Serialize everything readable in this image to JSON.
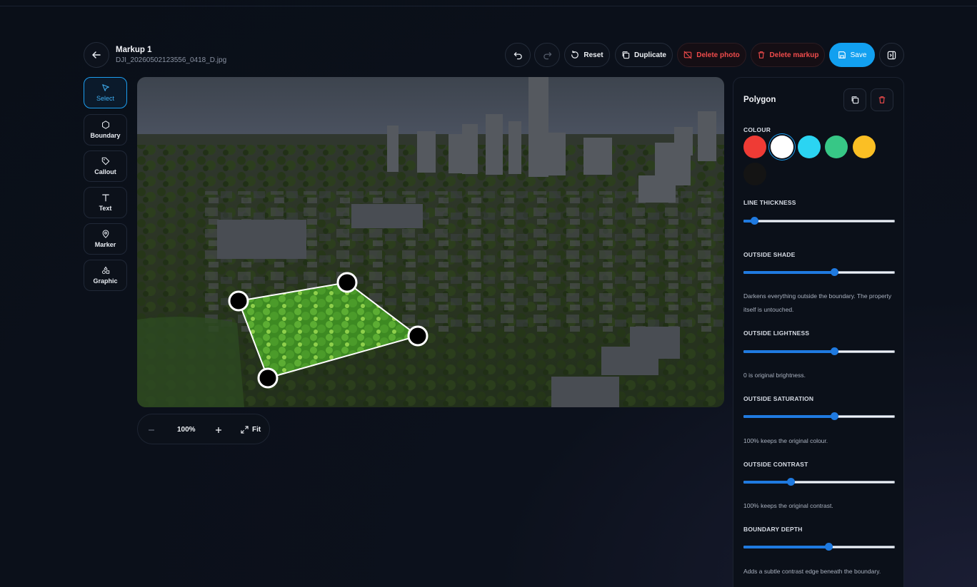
{
  "header": {
    "title": "Markup 1",
    "filename": "DJI_20260502123556_0418_D.jpg",
    "reset_label": "Reset",
    "duplicate_label": "Duplicate",
    "delete_photo_label": "Delete photo",
    "delete_markup_label": "Delete markup",
    "save_label": "Save"
  },
  "tools": [
    {
      "label": "Select",
      "icon": "cursor-icon",
      "active": true
    },
    {
      "label": "Boundary",
      "icon": "hexagon-icon",
      "active": false
    },
    {
      "label": "Callout",
      "icon": "tag-icon",
      "active": false
    },
    {
      "label": "Text",
      "icon": "text-icon",
      "active": false
    },
    {
      "label": "Marker",
      "icon": "map-pin-icon",
      "active": false
    },
    {
      "label": "Graphic",
      "icon": "shapes-icon",
      "active": false
    }
  ],
  "zoom": {
    "level": "100%",
    "fit_label": "Fit"
  },
  "panel": {
    "title": "Polygon",
    "colour_label": "COLOUR",
    "colours": [
      "#ef3b35",
      "#ffffff",
      "#2bd4f2",
      "#37c786",
      "#fbbf24",
      "#141414"
    ],
    "selected_colour": "#ffffff",
    "line_thickness_label": "LINE THICKNESS",
    "line_thickness": 0.07,
    "outside_shade_label": "OUTSIDE SHADE",
    "outside_shade": 0.6,
    "outside_shade_help": "Darkens everything outside the boundary. The property itself is untouched.",
    "outside_lightness_label": "OUTSIDE LIGHTNESS",
    "outside_lightness": 0.6,
    "outside_lightness_help": "0 is original brightness.",
    "outside_saturation_label": "OUTSIDE SATURATION",
    "outside_saturation": 0.6,
    "outside_saturation_help": "100% keeps the original colour.",
    "outside_contrast_label": "OUTSIDE CONTRAST",
    "outside_contrast": 0.31,
    "outside_contrast_help": "100% keeps the original contrast.",
    "boundary_depth_label": "BOUNDARY DEPTH",
    "boundary_depth": 0.56,
    "boundary_depth_help": "Adds a subtle contrast edge beneath the boundary."
  }
}
